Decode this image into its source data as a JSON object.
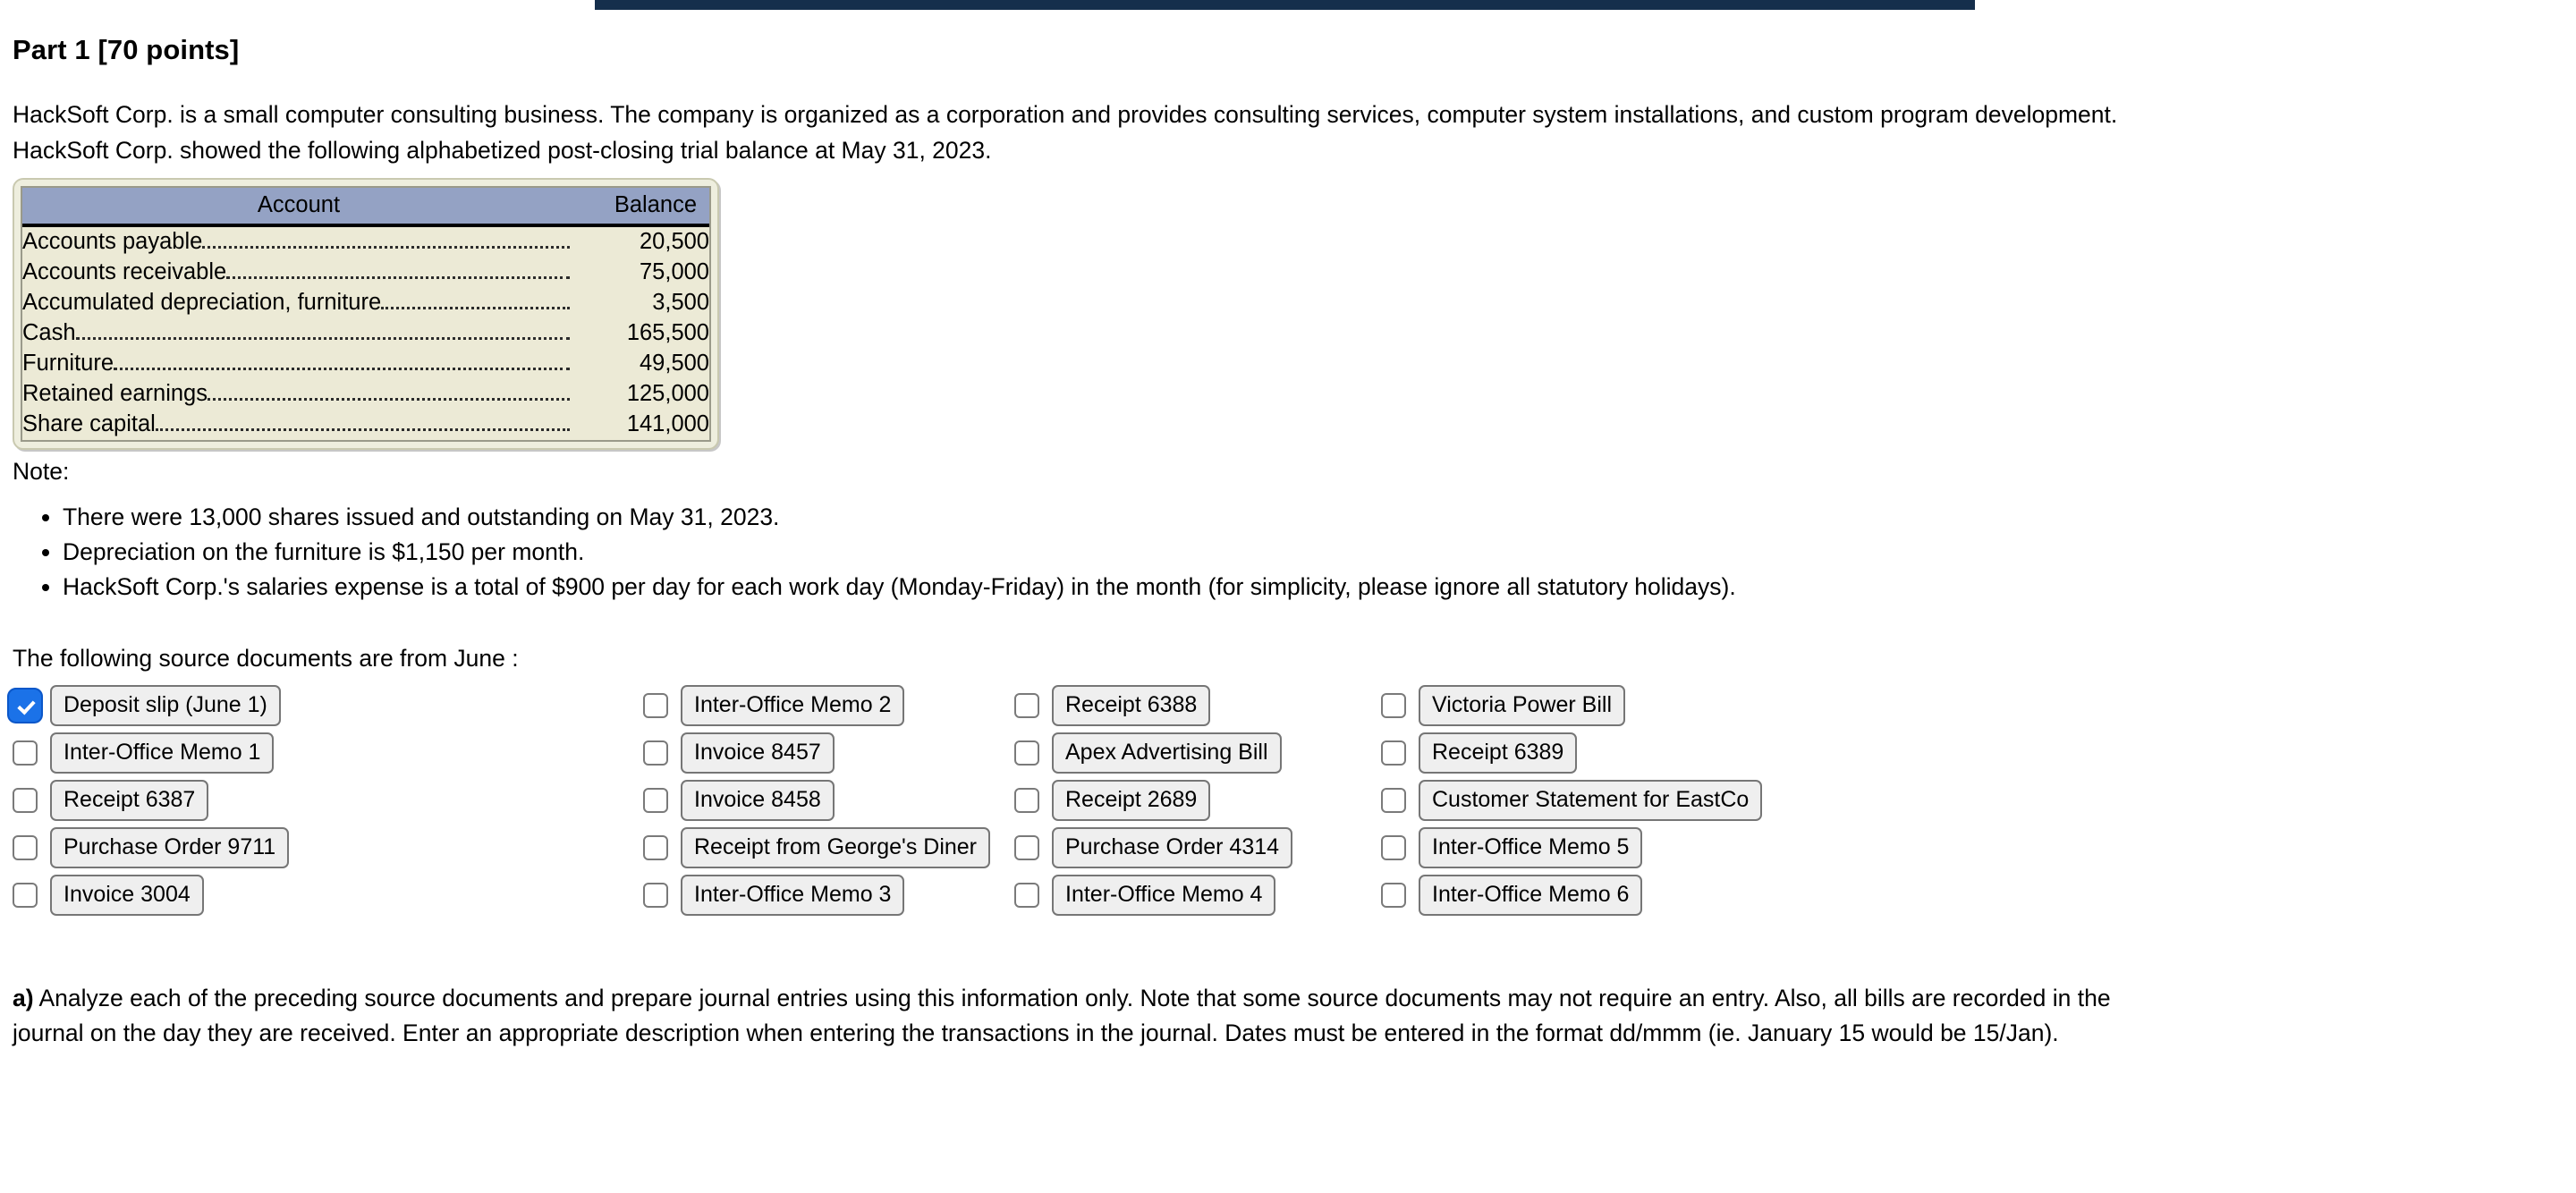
{
  "theme": {
    "top_bar_color": "#152f4c",
    "table_header_color": "#94a2c4",
    "table_body_color": "#ecead6",
    "checkbox_checked_color": "#1b72e8",
    "button_face_color": "#efefef"
  },
  "heading": "Part 1 [70 points]",
  "intro": {
    "line1": "HackSoft Corp. is a small computer consulting business. The company is organized as a corporation and provides consulting services, computer system installations, and custom program development.",
    "line2": "HackSoft Corp. showed the following alphabetized post-closing trial balance at May 31, 2023."
  },
  "trial_balance": {
    "columns": [
      "Account",
      "Balance"
    ],
    "rows": [
      {
        "account": "Accounts payable",
        "balance": "20,500"
      },
      {
        "account": "Accounts receivable",
        "balance": "75,000"
      },
      {
        "account": "Accumulated depreciation, furniture",
        "balance": "3,500"
      },
      {
        "account": "Cash",
        "balance": "165,500"
      },
      {
        "account": "Furniture",
        "balance": "49,500"
      },
      {
        "account": "Retained earnings",
        "balance": "125,000"
      },
      {
        "account": "Share capital",
        "balance": "141,000"
      }
    ]
  },
  "note": {
    "label": "Note:",
    "items": [
      "There were 13,000 shares issued and outstanding on May 31, 2023.",
      "Depreciation on the furniture is $1,150 per month.",
      "HackSoft Corp.'s salaries expense is a total of $900 per day for each work day (Monday-Friday) in the month (for simplicity, please ignore all statutory holidays)."
    ]
  },
  "documents": {
    "lead": "The following source documents are from June :",
    "items": [
      {
        "label": "Deposit slip (June 1)",
        "checked": true
      },
      {
        "label": "Inter-Office Memo 2",
        "checked": false
      },
      {
        "label": "Receipt 6388",
        "checked": false
      },
      {
        "label": "Victoria Power Bill",
        "checked": false
      },
      {
        "label": "Inter-Office Memo 1",
        "checked": false
      },
      {
        "label": "Invoice 8457",
        "checked": false
      },
      {
        "label": "Apex Advertising Bill",
        "checked": false
      },
      {
        "label": "Receipt 6389",
        "checked": false
      },
      {
        "label": "Receipt 6387",
        "checked": false
      },
      {
        "label": "Invoice 8458",
        "checked": false
      },
      {
        "label": "Receipt 2689",
        "checked": false
      },
      {
        "label": "Customer Statement for EastCo",
        "checked": false
      },
      {
        "label": "Purchase Order 9711",
        "checked": false
      },
      {
        "label": "Receipt from George's Diner",
        "checked": false
      },
      {
        "label": "Purchase Order 4314",
        "checked": false
      },
      {
        "label": "Inter-Office Memo 5",
        "checked": false
      },
      {
        "label": "Invoice 3004",
        "checked": false
      },
      {
        "label": "Inter-Office Memo 3",
        "checked": false
      },
      {
        "label": "Inter-Office Memo 4",
        "checked": false
      },
      {
        "label": "Inter-Office Memo 6",
        "checked": false
      }
    ]
  },
  "question_a": {
    "marker": "a)",
    "line1": " Analyze each of the preceding source documents and prepare journal entries using this information only. Note that some source documents may not require an entry. Also, all bills are recorded in the",
    "line2": "journal on the day they are received. Enter an appropriate description when entering the transactions in the journal. Dates must be entered in the format dd/mmm (ie. January 15 would be 15/Jan)."
  }
}
